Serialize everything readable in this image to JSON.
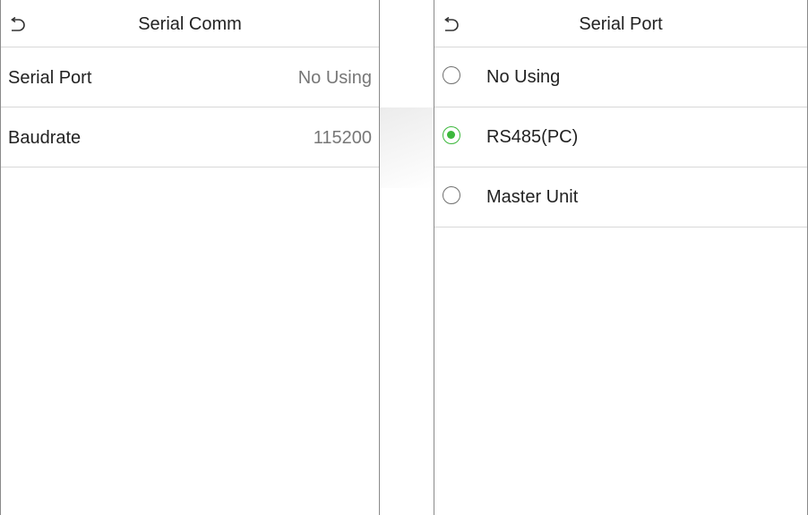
{
  "left": {
    "title": "Serial Comm",
    "rows": [
      {
        "label": "Serial Port",
        "value": "No Using"
      },
      {
        "label": "Baudrate",
        "value": "115200"
      }
    ]
  },
  "right": {
    "title": "Serial Port",
    "options": [
      {
        "label": "No Using",
        "selected": false
      },
      {
        "label": "RS485(PC)",
        "selected": true
      },
      {
        "label": "Master Unit",
        "selected": false
      }
    ]
  },
  "colors": {
    "accent_radio": "#3cb83c",
    "value_text": "#777777",
    "divider": "#d8d8d8"
  },
  "icons": {
    "back": "return-arrow-icon"
  }
}
